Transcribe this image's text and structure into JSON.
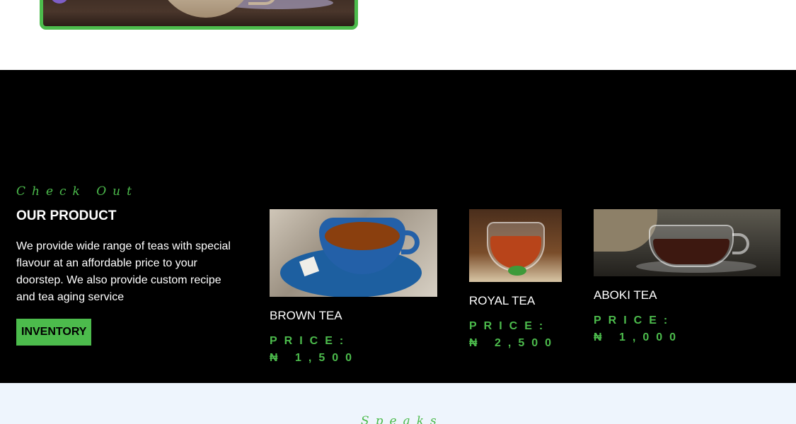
{
  "hero": {
    "image": "tea-cup-photo"
  },
  "product_section": {
    "eyebrow": "Check Out",
    "title": "OUR PRODUCT",
    "description": "We provide wide range of teas with special flavour at an affordable price to your doorstep. We also provide custom recipe and tea aging service",
    "button_label": "INVENTORY",
    "colors": {
      "accent": "#4cbb4c",
      "background": "#000000"
    },
    "products": [
      {
        "name": "BROWN TEA",
        "price_label": "PRICE:",
        "price_value": "₦ 1,500",
        "image": "brown-tea-photo"
      },
      {
        "name": "ROYAL TEA",
        "price_label": "PRICE:",
        "price_value": "₦ 2,500",
        "image": "royal-tea-photo"
      },
      {
        "name": "ABOKI TEA",
        "price_label": "PRICE:",
        "price_value": "₦ 1,000",
        "image": "aboki-tea-photo"
      }
    ]
  },
  "next_section": {
    "eyebrow": "Speaks"
  }
}
